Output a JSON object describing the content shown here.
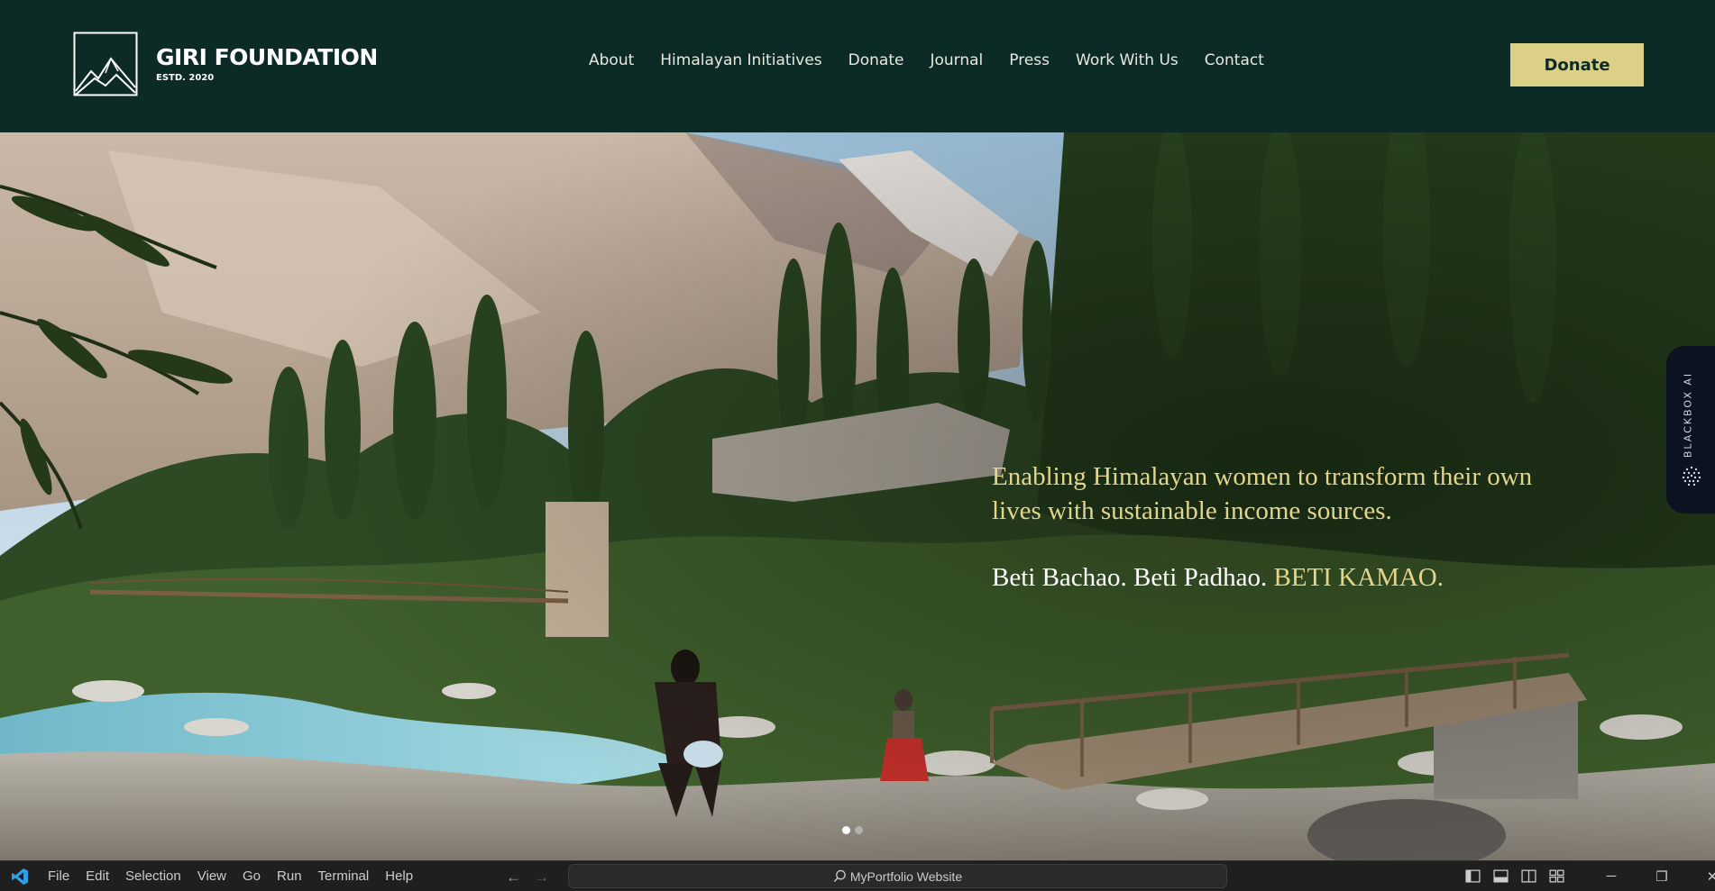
{
  "brand": {
    "name": "GIRI FOUNDATION",
    "established": "ESTD. 2020"
  },
  "nav": {
    "items": [
      {
        "label": "About"
      },
      {
        "label": "Himalayan Initiatives"
      },
      {
        "label": "Donate"
      },
      {
        "label": "Journal"
      },
      {
        "label": "Press"
      },
      {
        "label": "Work With Us"
      },
      {
        "label": "Contact"
      }
    ],
    "cta_label": "Donate"
  },
  "hero": {
    "tagline": "Enabling Himalayan women to transform their own lives with sustainable income sources.",
    "slogan_part1": "Beti Bachao. Beti Padhao. ",
    "slogan_part2": "BETI KAMAO.",
    "slides_total": 2,
    "slide_active": 1
  },
  "side_tab": {
    "label": "BLACKBOX AI",
    "icon": "dotted-orb-icon"
  },
  "editor": {
    "menu": [
      "File",
      "Edit",
      "Selection",
      "View",
      "Go",
      "Run",
      "Terminal",
      "Help"
    ],
    "search_text": "MyPortfolio Website",
    "icons": [
      "back-arrow-icon",
      "forward-arrow-icon",
      "search-icon",
      "primary-sidebar-layout-icon",
      "panel-layout-icon",
      "secondary-sidebar-layout-icon",
      "customize-layout-icon",
      "minimize-icon",
      "maximize-icon",
      "close-icon"
    ]
  },
  "colors": {
    "header_bg": "#0d2b26",
    "accent_gold": "#dccf86",
    "tagline_gold": "#e3d58b",
    "taskbar_bg": "#1f1f1f"
  }
}
